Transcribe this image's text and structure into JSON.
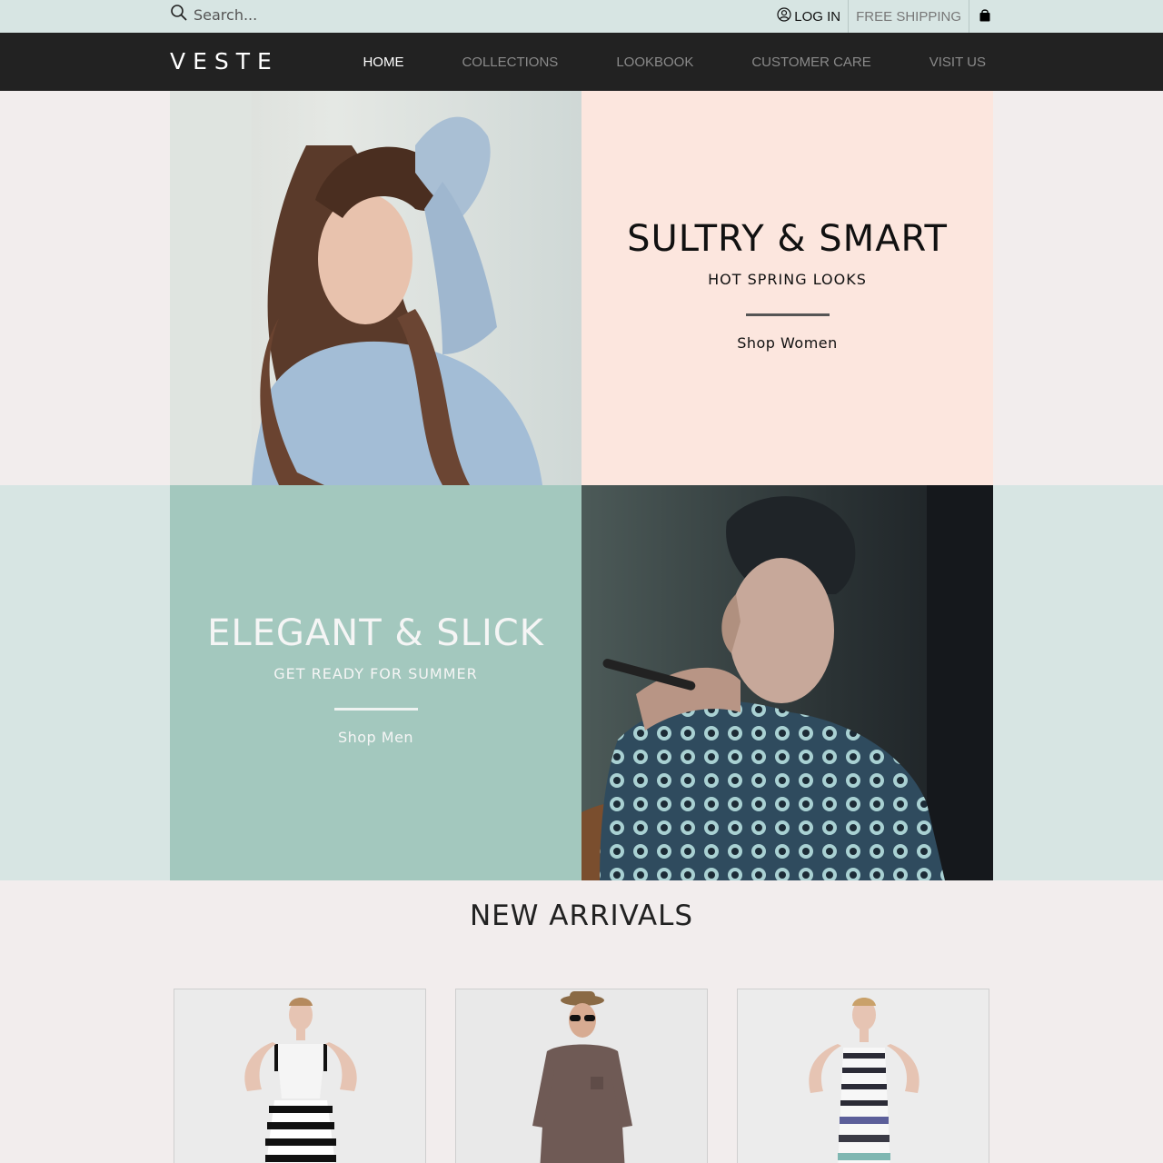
{
  "topbar": {
    "search_placeholder": "Search...",
    "login_label": "LOG IN",
    "shipping_label": "FREE SHIPPING"
  },
  "nav": {
    "logo": "VESTE",
    "items": [
      {
        "label": "HOME",
        "active": true
      },
      {
        "label": "COLLECTIONS",
        "active": false
      },
      {
        "label": "LOOKBOOK",
        "active": false
      },
      {
        "label": "CUSTOMER CARE",
        "active": false
      },
      {
        "label": "VISIT US",
        "active": false
      }
    ]
  },
  "promo_women": {
    "title": "SULTRY & SMART",
    "subtitle": "HOT SPRING LOOKS",
    "link": "Shop Women"
  },
  "promo_men": {
    "title": "ELEGANT & SLICK",
    "subtitle": "GET READY FOR SUMMER",
    "link": "Shop Men"
  },
  "new_arrivals": {
    "title": "NEW ARRIVALS"
  },
  "colors": {
    "topbar_bg": "#d7e5e3",
    "nav_bg": "#222222",
    "promo_women_bg": "#fce6de",
    "promo_men_bg": "#a3c8be",
    "page_bg": "#f2eded"
  },
  "icons": {
    "search": "search-icon",
    "login": "user-circle-icon",
    "cart": "shopping-bag-icon"
  }
}
